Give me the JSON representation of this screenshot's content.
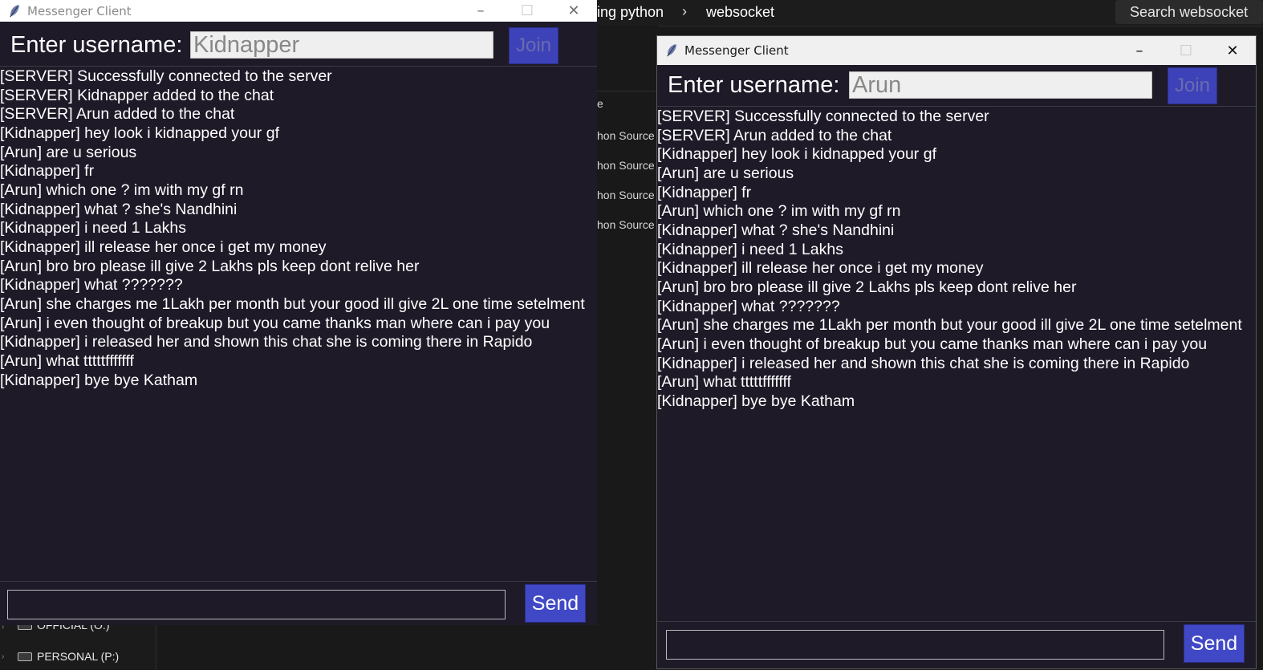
{
  "explorer": {
    "breadcrumb_1": "ing python",
    "breadcrumb_2": "websocket",
    "search_placeholder": "Search websocket",
    "column_fragment": "e",
    "file_types": [
      "hon Source",
      "hon Source",
      "hon Source",
      "hon Source"
    ],
    "drives": [
      "OFFICIAL (O:)",
      "PERSONAL (P:)"
    ]
  },
  "windows": [
    {
      "title": "Messenger Client",
      "username_label": "Enter username:",
      "username_value": "Kidnapper",
      "join_label": "Join",
      "send_label": "Send",
      "message_value": "",
      "messages": [
        "[SERVER] Successfully connected to the server",
        "[SERVER] Kidnapper added to the chat",
        "[SERVER] Arun added to the chat",
        "[Kidnapper] hey look i kidnapped your gf",
        "[Arun] are u serious",
        "[Kidnapper] fr",
        "[Arun] which one ? im with my gf rn",
        "[Kidnapper] what ? she's Nandhini",
        "[Kidnapper] i need 1 Lakhs",
        "[Kidnapper] ill release her once i get my money",
        "[Arun] bro bro please ill give 2 Lakhs pls keep dont relive her",
        "[Kidnapper] what ???????",
        "[Arun] she charges me 1Lakh per month but your good ill give 2L one time setelment",
        "[Arun] i even thought of breakup but you came thanks man where can i pay you",
        "[Kidnapper] i released her and shown this chat she is coming there in Rapido",
        "[Arun] what tttttfffffff",
        "[Kidnapper] bye bye Katham"
      ]
    },
    {
      "title": "Messenger Client",
      "username_label": "Enter username:",
      "username_value": "Arun",
      "join_label": "Join",
      "send_label": "Send",
      "message_value": "",
      "messages": [
        "[SERVER] Successfully connected to the server",
        "[SERVER] Arun added to the chat",
        "[Kidnapper] hey look i kidnapped your gf",
        "[Arun] are u serious",
        "[Kidnapper] fr",
        "[Arun] which one ? im with my gf rn",
        "[Kidnapper] what ? she's Nandhini",
        "[Kidnapper] i need 1 Lakhs",
        "[Kidnapper] ill release her once i get my money",
        "[Arun] bro bro please ill give 2 Lakhs pls keep dont relive her",
        "[Kidnapper] what ???????",
        "[Arun] she charges me 1Lakh per month but your good ill give 2L one time setelment",
        "[Arun] i even thought of breakup but you came thanks man where can i pay you",
        "[Kidnapper] i released her and shown this chat she is coming there in Rapido",
        "[Arun] what tttttfffffff",
        "[Kidnapper] bye bye Katham"
      ]
    }
  ]
}
